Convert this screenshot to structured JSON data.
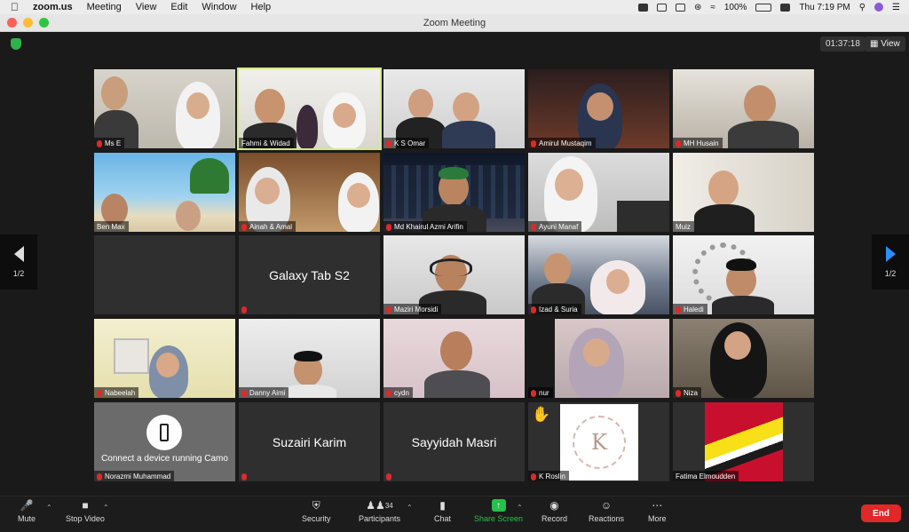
{
  "menubar": {
    "app": "zoom.us",
    "items": [
      "Meeting",
      "View",
      "Edit",
      "Window",
      "Help"
    ],
    "battery": "100%",
    "clock": "Thu 7:19 PM"
  },
  "window": {
    "title": "Zoom Meeting"
  },
  "meeting": {
    "timer": "01:37:18",
    "view_label": "View",
    "page_left": "1/2",
    "page_right": "1/2"
  },
  "tiles": [
    {
      "name": "Ms E"
    },
    {
      "name": "Fahmi & Widad"
    },
    {
      "name": "K S Omar"
    },
    {
      "name": "Amirul Mustaqim"
    },
    {
      "name": "MH Husain"
    },
    {
      "name": "Ben Max"
    },
    {
      "name": "Ainah & Amal"
    },
    {
      "name": "Md Khairul Azmi Arifin"
    },
    {
      "name": "Ayuni Manaf"
    },
    {
      "name": "Muiz"
    },
    {
      "name": ""
    },
    {
      "title": "Galaxy Tab S2"
    },
    {
      "name": "Maziri Morsidi"
    },
    {
      "name": "Izad & Suria"
    },
    {
      "name": "Haledi"
    },
    {
      "name": "Nabeelah"
    },
    {
      "name": "Danny Aimi"
    },
    {
      "name": "cydn"
    },
    {
      "name": "nur"
    },
    {
      "name": "Niza"
    },
    {
      "name": "Norazmi Muhammad",
      "camo": "Connect a device running Camo"
    },
    {
      "title": "Suzairi Karim"
    },
    {
      "title": "Sayyidah Masri"
    },
    {
      "name": "K Roslin",
      "logo": "K"
    },
    {
      "name": "Fatima Elmoudden"
    }
  ],
  "toolbar": {
    "mute": "Mute",
    "stop_video": "Stop Video",
    "security": "Security",
    "participants": "Participants",
    "participants_count": "34",
    "chat": "Chat",
    "share_screen": "Share Screen",
    "record": "Record",
    "reactions": "Reactions",
    "more": "More",
    "end": "End"
  },
  "colors": {
    "accent": "#2d8cff",
    "share": "#26c14b",
    "end": "#e02828",
    "active_speaker": "#d4e88a"
  }
}
